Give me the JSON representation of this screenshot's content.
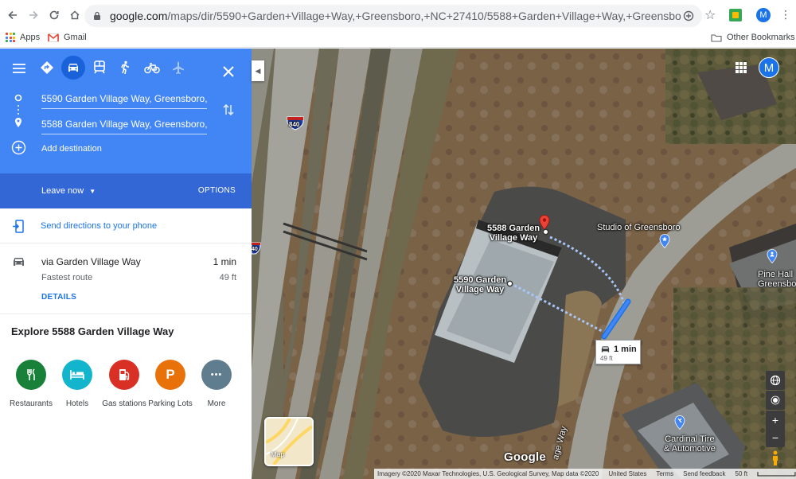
{
  "browser": {
    "url_host": "google.com",
    "url_rest": "/maps/dir/5590+Garden+Village+Way,+Greensboro,+NC+27410/5588+Garden+Village+Way,+Greensboro,+NC+27410/@36....",
    "profile_initial": "M"
  },
  "bookmarks": {
    "apps": "Apps",
    "gmail": "Gmail",
    "other": "Other Bookmarks"
  },
  "directions": {
    "origin": "5590 Garden Village Way, Greensboro, N",
    "destination": "5588 Garden Village Way, Greensboro, N",
    "add_destination": "Add destination",
    "leave_now": "Leave now",
    "options": "OPTIONS",
    "send_to_phone": "Send directions to your phone",
    "route": {
      "via": "via Garden Village Way",
      "time": "1 min",
      "subtitle": "Fastest route",
      "distance": "49 ft",
      "details": "DETAILS"
    },
    "explore_title": "Explore 5588 Garden Village Way",
    "explore_items": [
      {
        "label": "Restaurants",
        "color": "#188038",
        "icon": "fork-knife-icon"
      },
      {
        "label": "Hotels",
        "color": "#12b5cb",
        "icon": "bed-icon"
      },
      {
        "label": "Gas stations",
        "color": "#d93025",
        "icon": "fuel-pump-icon"
      },
      {
        "label": "Parking Lots",
        "color": "#e8710a",
        "icon": "parking-icon",
        "glyph": "P"
      },
      {
        "label": "More",
        "color": "#5f7d8e",
        "icon": "more-dots-icon",
        "glyph": "•••"
      }
    ]
  },
  "map": {
    "labels": {
      "dest": "5588 Garden\nVillage Way",
      "origin": "5590 Garden\nVillage Way",
      "studio": "Studio of Greensboro",
      "pine_hall": "Pine Hall\nGreensbo",
      "cardinal": "Cardinal Tire\n& Automotive",
      "road": "age Way",
      "highway": "840",
      "highway2": "40"
    },
    "info_box": {
      "time": "1 min",
      "distance": "49 ft"
    },
    "thumb_label": "Map",
    "google": "Google",
    "footer": [
      "Imagery ©2020 Maxar Technologies, U.S. Geological Survey, Map data ©2020",
      "United States",
      "Terms",
      "Send feedback",
      "50 ft"
    ],
    "avatar": "M"
  }
}
